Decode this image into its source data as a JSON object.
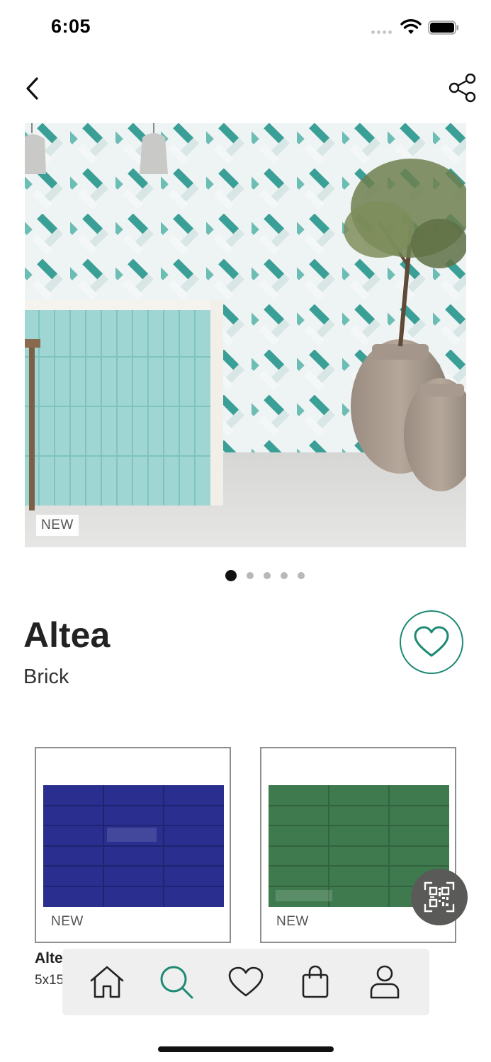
{
  "status_bar": {
    "time": "6:05"
  },
  "icons": {
    "back": "chevron-left-icon",
    "share": "share-icon",
    "favorite": "heart-outline-icon",
    "qr": "qr-code-icon",
    "tab_home": "home-icon",
    "tab_search": "search-icon",
    "tab_favorites": "heart-icon",
    "tab_bag": "shopping-bag-icon",
    "tab_profile": "user-icon"
  },
  "hero": {
    "badge": "NEW"
  },
  "pagination": {
    "total": 5,
    "active_index": 0
  },
  "product": {
    "title": "Altea",
    "subtitle": "Brick"
  },
  "variants": [
    {
      "badge": "NEW",
      "color": "#2a2f8f"
    },
    {
      "badge": "NEW",
      "color": "#3f7a4f"
    }
  ],
  "variant_caption": {
    "name": "Alte",
    "size": "5x15"
  },
  "colors": {
    "accent": "#1e8a73",
    "tab_bar_bg": "#efefef",
    "qr_button_bg": "#5a5a59"
  }
}
